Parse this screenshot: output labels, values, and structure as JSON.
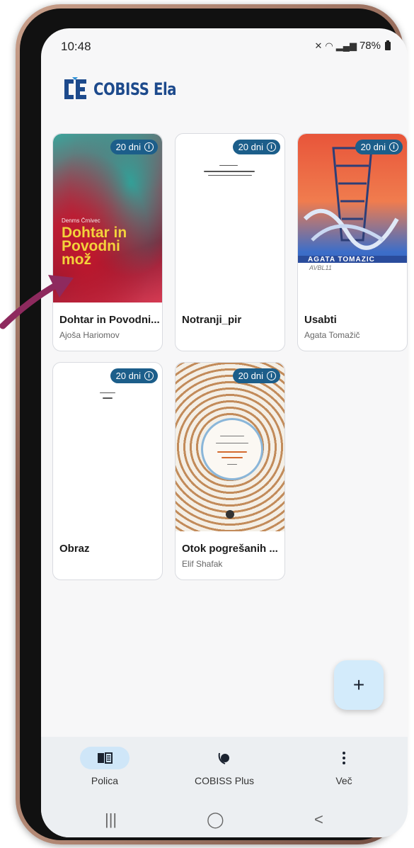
{
  "status": {
    "time": "10:48",
    "battery": "78%"
  },
  "app": {
    "logo_text": "COBISS Ela",
    "brand_color": "#1d4a8c",
    "accent_color": "#1c5e8a"
  },
  "books": [
    {
      "title": "Dohtar in Povodni...",
      "author": "Ajoša Hariomov",
      "badge": "20 dni",
      "cover_title": "Dohtar in Povodni mož",
      "cover_sub": "Denms Črnivec"
    },
    {
      "title": "Notranji_pir",
      "author": "",
      "badge": "20 dni"
    },
    {
      "title": "Usabti",
      "author": "Agata Tomažič",
      "badge": "20 dni",
      "cover_author": "AGATA TOMAZIC",
      "cover_title": "AVBL11"
    },
    {
      "title": "Obraz",
      "author": "",
      "badge": "20 dni"
    },
    {
      "title": "Otok pogrešanih ...",
      "author": "Elif Shafak",
      "badge": "20 dni"
    }
  ],
  "fab": {
    "label": "+"
  },
  "nav": {
    "items": [
      {
        "label": "Polica",
        "icon": "book-icon"
      },
      {
        "label": "COBISS Plus",
        "icon": "cobiss-plus-icon"
      },
      {
        "label": "Več",
        "icon": "more-vertical-icon"
      }
    ]
  },
  "system_nav": {
    "recent": "|||",
    "home": "◯",
    "back": "<"
  }
}
